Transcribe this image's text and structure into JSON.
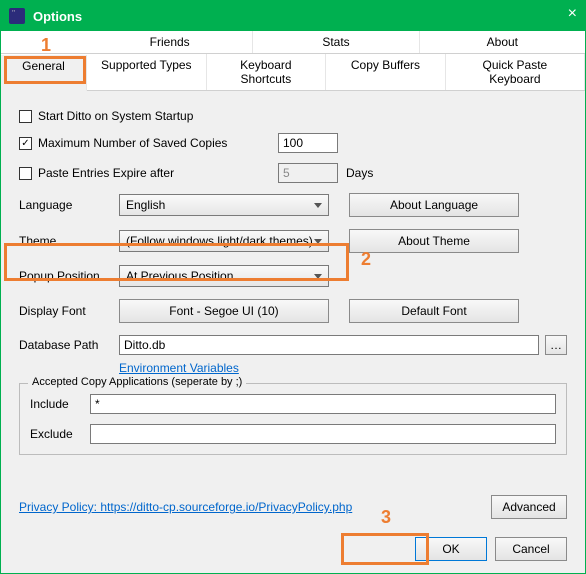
{
  "window": {
    "title": "Options"
  },
  "tabs_top": [
    "Friends",
    "Stats",
    "About"
  ],
  "tabs_bottom": [
    "General",
    "Supported Types",
    "Keyboard Shortcuts",
    "Copy Buffers",
    "Quick Paste Keyboard"
  ],
  "startup": {
    "label": "Start Ditto on System Startup",
    "checked": false
  },
  "max_copies": {
    "label": "Maximum Number of Saved Copies",
    "checked": true,
    "value": "100"
  },
  "expire": {
    "label": "Paste Entries Expire after",
    "checked": false,
    "value": "5",
    "unit": "Days"
  },
  "language": {
    "label": "Language",
    "value": "English",
    "button": "About Language"
  },
  "theme": {
    "label": "Theme",
    "value": "(Follow windows light/dark themes)",
    "button": "About Theme"
  },
  "popup": {
    "label": "Popup Position",
    "value": "At Previous Position"
  },
  "font": {
    "label": "Display Font",
    "button": "Font - Segoe UI (10)",
    "default": "Default Font"
  },
  "db": {
    "label": "Database Path",
    "value": "Ditto.db",
    "envlink": "Environment Variables"
  },
  "apps": {
    "legend": "Accepted Copy Applications (seperate by ;)",
    "include_label": "Include",
    "include_value": "*",
    "exclude_label": "Exclude",
    "exclude_value": ""
  },
  "privacy": {
    "text": "Privacy Policy: https://ditto-cp.sourceforge.io/PrivacyPolicy.php"
  },
  "buttons": {
    "advanced": "Advanced",
    "ok": "OK",
    "cancel": "Cancel"
  },
  "annotations": {
    "n1": "1",
    "n2": "2",
    "n3": "3"
  }
}
